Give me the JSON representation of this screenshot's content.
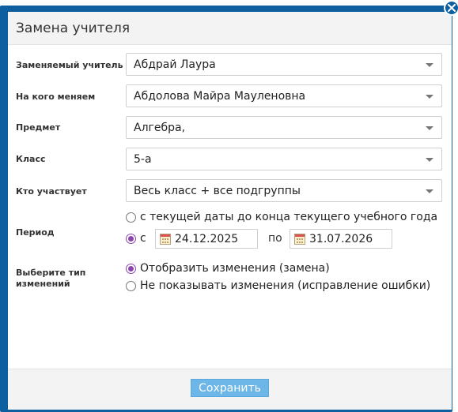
{
  "dialog": {
    "title": "Замена учителя",
    "save_label": "Сохранить"
  },
  "fields": {
    "replaced_teacher": {
      "label": "Заменяемый учитель",
      "value": "Абдрай Лаура"
    },
    "new_teacher": {
      "label": "На кого меняем",
      "value": "Абдолова Майра Мауленовна"
    },
    "subject": {
      "label": "Предмет",
      "value": "Алгебра,"
    },
    "class": {
      "label": "Класс",
      "value": "5-а"
    },
    "participants": {
      "label": "Кто участвует",
      "value": "Весь класс + все подгруппы"
    }
  },
  "period": {
    "label": "Период",
    "option_year": "с текущей даты до конца текущего учебного года",
    "option_range": "с",
    "from_date": "24.12.2025",
    "to_label": "по",
    "to_date": "31.07.2026",
    "selected": "range"
  },
  "change_type": {
    "label": "Выберите тип изменений",
    "option_show": "Отобразить изменения (замена)",
    "option_hide": "Не показывать изменения (исправление ошибки)",
    "selected": "show"
  },
  "colors": {
    "frame": "#0e5fa0",
    "accent_radio": "#8e44ad",
    "save_button": "#6cb6e8"
  },
  "icons": [
    "close-icon",
    "chevron-down-icon",
    "calendar-icon"
  ]
}
